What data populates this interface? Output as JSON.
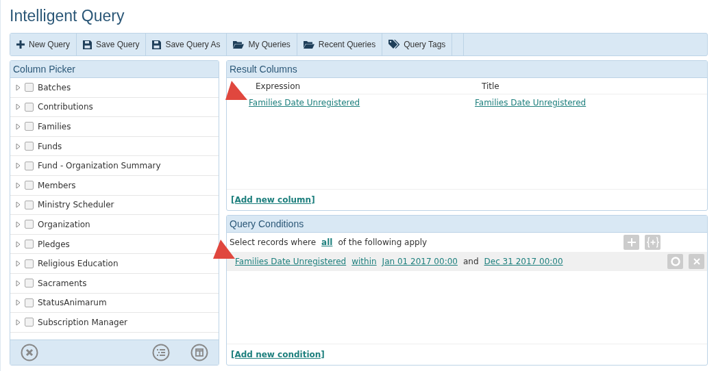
{
  "title": "Intelligent Query",
  "toolbar": [
    {
      "label": "New Query",
      "kind": "plus"
    },
    {
      "label": "Save Query",
      "kind": "save"
    },
    {
      "label": "Save Query As",
      "kind": "save"
    },
    {
      "label": "My Queries",
      "kind": "folder"
    },
    {
      "label": "Recent Queries",
      "kind": "folder"
    },
    {
      "label": "Query Tags",
      "kind": "tag"
    }
  ],
  "column_picker": {
    "title": "Column Picker",
    "items": [
      {
        "label": "Batches",
        "checked": false
      },
      {
        "label": "Contributions",
        "checked": false
      },
      {
        "label": "Families",
        "checked": false
      },
      {
        "label": "Funds",
        "checked": false
      },
      {
        "label": "Fund - Organization Summary",
        "checked": false
      },
      {
        "label": "Members",
        "checked": false
      },
      {
        "label": "Ministry Scheduler",
        "checked": false
      },
      {
        "label": "Organization",
        "checked": false
      },
      {
        "label": "Pledges",
        "checked": false
      },
      {
        "label": "Religious Education",
        "checked": false
      },
      {
        "label": "Sacraments",
        "checked": false
      },
      {
        "label": "StatusAnimarum",
        "checked": false
      },
      {
        "label": "Subscription Manager",
        "checked": false
      }
    ]
  },
  "result_columns": {
    "title": "Result Columns",
    "columns": [
      "Expression",
      "Title"
    ],
    "rows": [
      [
        "Families Date Unregistered",
        "Families Date Unregistered"
      ]
    ],
    "add_link": "[Add new column]"
  },
  "query_conditions": {
    "title": "Query Conditions",
    "intro_before": "Select records where",
    "match": "all",
    "intro_after": "of the following apply",
    "conditions": [
      {
        "field": "Families Date Unregistered",
        "operator": "within",
        "from": "Jan 01 2017 00:00",
        "joiner": "and",
        "to": "Dec 31 2017 00:00"
      }
    ],
    "add_link": "[Add new condition]"
  }
}
